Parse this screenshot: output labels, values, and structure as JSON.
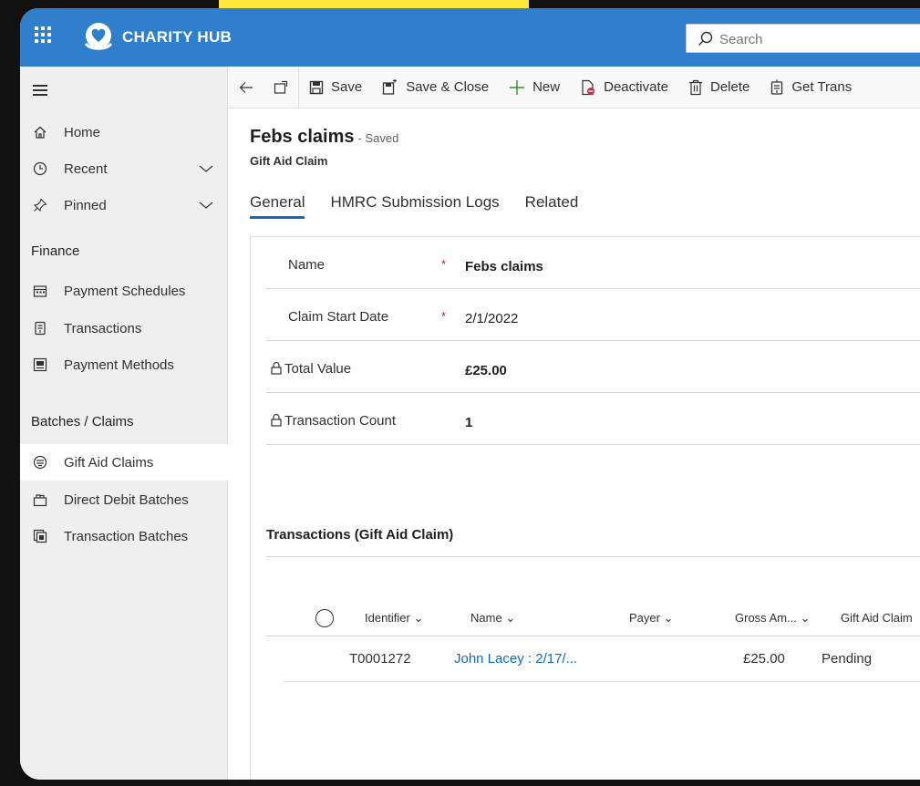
{
  "header": {
    "app_title": "CHARITY HUB",
    "search_placeholder": "Search"
  },
  "sidebar": {
    "items": [
      {
        "label": "Home",
        "icon": "home-icon"
      },
      {
        "label": "Recent",
        "icon": "clock-icon"
      },
      {
        "label": "Pinned",
        "icon": "pin-icon"
      }
    ],
    "sections": [
      {
        "title": "Finance",
        "items": [
          {
            "label": "Payment Schedules",
            "icon": "calendar-icon"
          },
          {
            "label": "Transactions",
            "icon": "transactions-icon"
          },
          {
            "label": "Payment Methods",
            "icon": "card-icon"
          }
        ]
      },
      {
        "title": "Batches / Claims",
        "items": [
          {
            "label": "Gift Aid Claims",
            "icon": "gift-aid-icon",
            "active": true
          },
          {
            "label": "Direct Debit Batches",
            "icon": "batch-icon"
          },
          {
            "label": "Transaction Batches",
            "icon": "stack-icon"
          }
        ]
      }
    ]
  },
  "toolbar": {
    "save": "Save",
    "save_close": "Save & Close",
    "new": "New",
    "deactivate": "Deactivate",
    "delete": "Delete",
    "get_trans": "Get Trans"
  },
  "record": {
    "title": "Febs claims",
    "status": "- Saved",
    "entity": "Gift Aid Claim"
  },
  "tabs": [
    "General",
    "HMRC Submission Logs",
    "Related"
  ],
  "fields": [
    {
      "label": "Name",
      "required": "*",
      "value": "Febs claims"
    },
    {
      "label": "Claim Start Date",
      "required": "*",
      "value": "2/1/2022"
    },
    {
      "label": "Total Value",
      "value": "£25.00"
    },
    {
      "label": "Transaction Count",
      "value": "1"
    }
  ],
  "subgrid": {
    "title": "Transactions (Gift Aid Claim)",
    "columns": [
      "Identifier",
      "Name",
      "Payer",
      "Gross Am...",
      "Gift Aid Claim"
    ],
    "rows": [
      {
        "identifier": "T0001272",
        "name": "John Lacey : 2/17/...",
        "payer": "",
        "gross": "£25.00",
        "gift_aid": "Pending"
      }
    ]
  },
  "colors": {
    "topbar": "#2f7fcd",
    "accent": "#0f6cbd",
    "sidebar_bg": "#efefef",
    "required": "#a4262c",
    "new_icon": "#3a8a3a",
    "deactivate_icon": "#c4314b"
  }
}
